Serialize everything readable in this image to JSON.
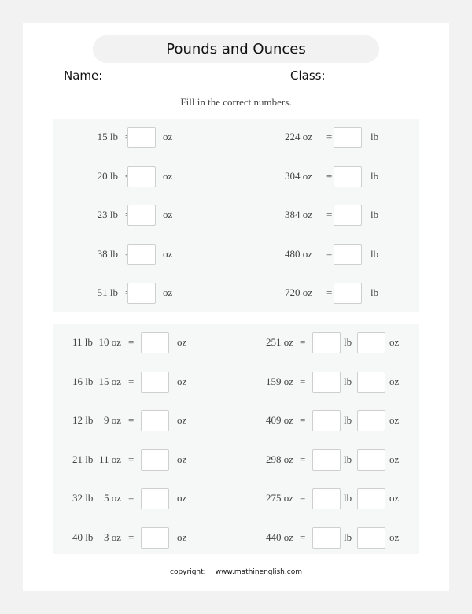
{
  "worksheet": {
    "title": "Pounds and Ounces",
    "name_label": "Name:",
    "class_label": "Class:",
    "instruction": "Fill in the correct numbers.",
    "equals": "="
  },
  "section1": {
    "left": [
      {
        "given": "15 lb",
        "unit": "oz"
      },
      {
        "given": "20 lb",
        "unit": "oz"
      },
      {
        "given": "23 lb",
        "unit": "oz"
      },
      {
        "given": "38 lb",
        "unit": "oz"
      },
      {
        "given": "51 lb",
        "unit": "oz"
      }
    ],
    "right": [
      {
        "given": "224 oz",
        "unit": "lb"
      },
      {
        "given": "304 oz",
        "unit": "lb"
      },
      {
        "given": "384 oz",
        "unit": "lb"
      },
      {
        "given": "480 oz",
        "unit": "lb"
      },
      {
        "given": "720 oz",
        "unit": "lb"
      }
    ]
  },
  "section2": {
    "left": [
      {
        "lb": "11 lb",
        "oz": "10 oz",
        "unit": "oz"
      },
      {
        "lb": "16 lb",
        "oz": "15 oz",
        "unit": "oz"
      },
      {
        "lb": "12 lb",
        "oz": "9 oz",
        "unit": "oz"
      },
      {
        "lb": "21 lb",
        "oz": "11 oz",
        "unit": "oz"
      },
      {
        "lb": "32 lb",
        "oz": "5 oz",
        "unit": "oz"
      },
      {
        "lb": "40 lb",
        "oz": "3 oz",
        "unit": "oz"
      }
    ],
    "right": [
      {
        "given": "251 oz",
        "unit1": "lb",
        "unit2": "oz"
      },
      {
        "given": "159 oz",
        "unit1": "lb",
        "unit2": "oz"
      },
      {
        "given": "409 oz",
        "unit1": "lb",
        "unit2": "oz"
      },
      {
        "given": "298 oz",
        "unit1": "lb",
        "unit2": "oz"
      },
      {
        "given": "275 oz",
        "unit1": "lb",
        "unit2": "oz"
      },
      {
        "given": "440 oz",
        "unit1": "lb",
        "unit2": "oz"
      }
    ]
  },
  "footer": {
    "copyright_label": "copyright:",
    "site": "www.mathinenglish.com"
  }
}
